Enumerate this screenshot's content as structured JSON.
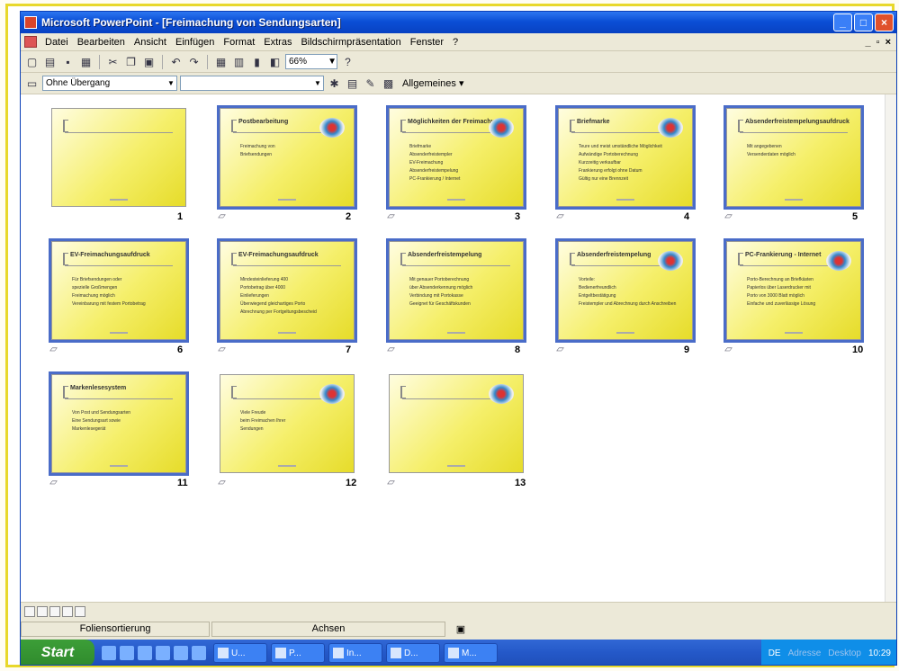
{
  "window": {
    "title": "Microsoft PowerPoint - [Freimachung von Sendungsarten]"
  },
  "menu": [
    "Datei",
    "Bearbeiten",
    "Ansicht",
    "Einfügen",
    "Format",
    "Extras",
    "Bildschirmpräsentation",
    "Fenster",
    "?"
  ],
  "toolbar": {
    "zoom": "66%",
    "transition": "Ohne Übergang",
    "effect": "",
    "general": "Allgemeines ▾"
  },
  "slides": [
    {
      "num": "1",
      "title": "",
      "body": []
    },
    {
      "num": "2",
      "title": "Postbearbeitung",
      "body": [
        "Freimachung von",
        "Briefsendungen"
      ]
    },
    {
      "num": "3",
      "title": "Möglichkeiten der Freimachung",
      "body": [
        "Briefmarke",
        "Absenderfreistempler",
        "EV-Freimachung",
        "Absenderfreistempelung",
        "PC-Frankierung / Internet"
      ]
    },
    {
      "num": "4",
      "title": "Briefmarke",
      "body": [
        "Teure und meist umständliche Möglichkeit",
        "Aufwändige Portoberechnung",
        "Kurzzeitig verkaufbar",
        "Frankierung erfolgt ohne Datum",
        "Gültig nur eine Brennzeit"
      ]
    },
    {
      "num": "5",
      "title": "Absenderfreistempelungsaufdruck",
      "body": [
        "Mit angegebenen",
        "Versenderdaten möglich"
      ]
    },
    {
      "num": "6",
      "title": "EV-Freimachungsaufdruck",
      "body": [
        "Für Briefsendungen oder",
        "spezielle Großmengen",
        "Freimachung möglich",
        "Vereinbarung mit festem Portobetrag"
      ]
    },
    {
      "num": "7",
      "title": "EV-Freimachungsaufdruck",
      "body": [
        "Mindesteinlieferung 400",
        "Portobetrag über 4000",
        "Einlieferungen",
        "Überwiegend gleichartiges Porto",
        "Abrechnung per Fortgeltungsbescheid"
      ]
    },
    {
      "num": "8",
      "title": "Absenderfreistempelung",
      "body": [
        "Mit genauer Portoberechnung",
        "über Absenderkennung möglich",
        "Verbindung mit Portokasse",
        "Geeignet für Geschäftskunden"
      ]
    },
    {
      "num": "9",
      "title": "Absenderfreistempelung",
      "body": [
        "Vorteile:",
        "Bedienerfreundlich",
        "Entgeltbestätigung",
        "Freistempler und Abrechnung durch Anschreiben"
      ]
    },
    {
      "num": "10",
      "title": "PC-Frankierung - Internet",
      "body": [
        "Porto-Berechnung an Briefkästen",
        "Papierlos über Laserdrucker mit",
        "Porto von 3000 Blatt möglich",
        "Einfache und zuverlässige Lösung"
      ]
    },
    {
      "num": "11",
      "title": "Markenlesesystem",
      "body": [
        "Von Post und Sendungsarten",
        "Eine Sendungsart sowie",
        "Markenlesegerät"
      ]
    },
    {
      "num": "12",
      "title": "",
      "body": [
        "Viele Freude",
        "beim Freimachen Ihrer",
        "Sendungen"
      ]
    },
    {
      "num": "13",
      "title": "",
      "body": []
    }
  ],
  "status": {
    "left": "Foliensortierung",
    "mid": "Achsen"
  },
  "taskbar": {
    "start": "Start",
    "tasks": [
      "U...",
      "P...",
      "In...",
      "D...",
      "M..."
    ],
    "lang": "DE",
    "tray_a": "Adresse",
    "tray_b": "Desktop",
    "clock": "10:29"
  }
}
